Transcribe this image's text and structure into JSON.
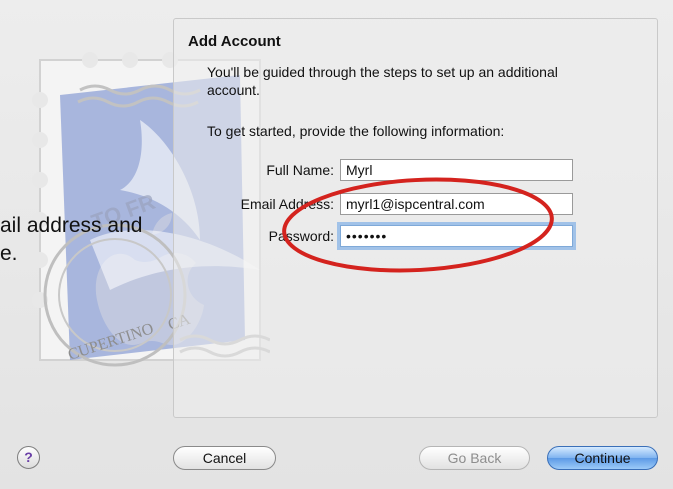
{
  "dialog": {
    "title": "Add Account",
    "intro": "You'll be guided through the steps to set up an additional account.",
    "prompt": "To get started, provide the following information:"
  },
  "form": {
    "full_name_label": "Full Name:",
    "full_name_value": "Myrl",
    "email_label": "Email Address:",
    "email_value": "myrl1@ispcentral.com",
    "password_label": "Password:",
    "password_value": "•••••••"
  },
  "callout": {
    "line1": "ail address and",
    "line2": "e."
  },
  "stamp": {
    "text_top": "TO FR",
    "text_bottom": "CUPERTINO",
    "text_bottom_suffix": "CA"
  },
  "buttons": {
    "help": "?",
    "cancel": "Cancel",
    "go_back": "Go Back",
    "continue": "Continue"
  },
  "colors": {
    "accent_blue": "#5c9ae6",
    "annotation_red": "#d4231e",
    "stamp_blue": "#8fa2d6"
  },
  "icons": {
    "help": "help-icon",
    "stamp": "mail-stamp-icon"
  }
}
